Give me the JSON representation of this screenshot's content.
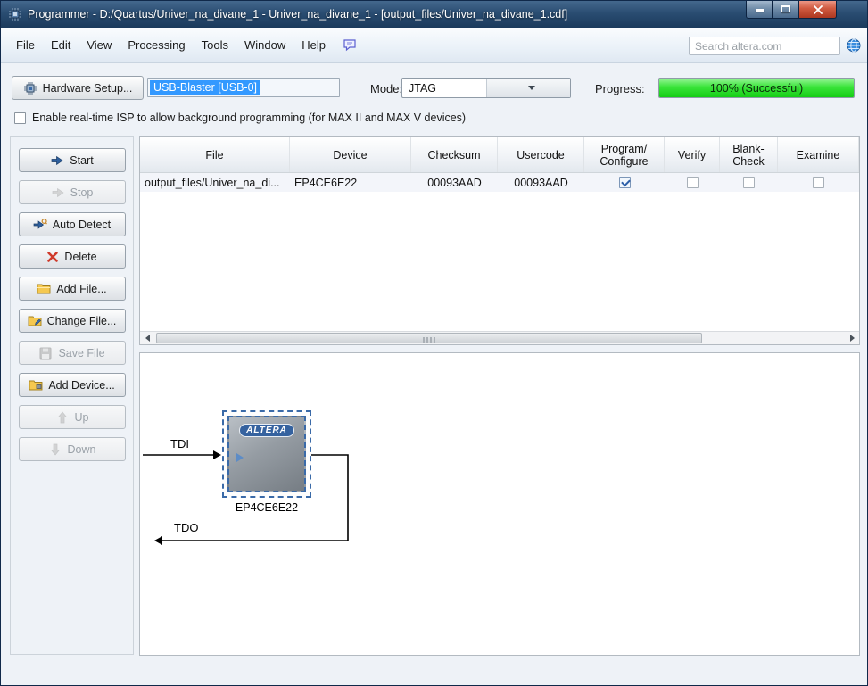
{
  "window": {
    "title": "Programmer - D:/Quartus/Univer_na_divane_1 - Univer_na_divane_1 - [output_files/Univer_na_divane_1.cdf]"
  },
  "menubar": {
    "items": [
      "File",
      "Edit",
      "View",
      "Processing",
      "Tools",
      "Window",
      "Help"
    ],
    "search_placeholder": "Search altera.com"
  },
  "toolbar": {
    "hardware_setup": "Hardware Setup...",
    "hardware_value": "USB-Blaster [USB-0]",
    "mode_label": "Mode:",
    "mode_value": "JTAG",
    "progress_label": "Progress:",
    "progress_text": "100% (Successful)",
    "progress_percent": 100,
    "progress_color": "#2ee02e",
    "selection_color": "#3399ff"
  },
  "isp": {
    "label": "Enable real-time ISP to allow background programming (for MAX II and MAX V devices)",
    "checked": false
  },
  "sidebar": {
    "buttons": [
      {
        "label": "Start",
        "enabled": true
      },
      {
        "label": "Stop",
        "enabled": false
      },
      {
        "label": "Auto Detect",
        "enabled": true
      },
      {
        "label": "Delete",
        "enabled": true
      },
      {
        "label": "Add File...",
        "enabled": true
      },
      {
        "label": "Change File...",
        "enabled": true
      },
      {
        "label": "Save File",
        "enabled": false
      },
      {
        "label": "Add Device...",
        "enabled": true
      },
      {
        "label": "Up",
        "enabled": false
      },
      {
        "label": "Down",
        "enabled": false
      }
    ]
  },
  "table": {
    "columns": [
      "File",
      "Device",
      "Checksum",
      "Usercode",
      "Program/\nConfigure",
      "Verify",
      "Blank-\nCheck",
      "Examine"
    ],
    "row": {
      "file": "output_files/Univer_na_di...",
      "device": "EP4CE6E22",
      "checksum": "00093AAD",
      "usercode": "00093AAD",
      "program_configure": true,
      "verify": false,
      "blank_check": false,
      "examine": false
    }
  },
  "diagram": {
    "tdi": "TDI",
    "tdo": "TDO",
    "chip_name": "EP4CE6E22",
    "chip_logo": "ALTERA"
  }
}
